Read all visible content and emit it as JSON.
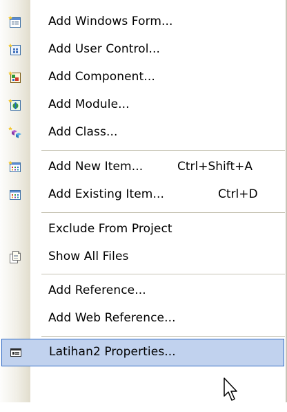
{
  "menu": {
    "items": [
      {
        "label": "Add Windows Form...",
        "icon": "windows-form-icon"
      },
      {
        "label": "Add User Control...",
        "icon": "user-control-icon"
      },
      {
        "label": "Add Component...",
        "icon": "component-icon"
      },
      {
        "label": "Add Module...",
        "icon": "module-icon"
      },
      {
        "label": "Add Class...",
        "icon": "class-icon"
      },
      {
        "label": "Add New Item...",
        "shortcut": "Ctrl+Shift+A",
        "icon": "new-item-icon"
      },
      {
        "label": "Add Existing Item...",
        "shortcut": "Ctrl+D",
        "icon": "existing-item-icon"
      },
      {
        "label": "Exclude From Project"
      },
      {
        "label": "Show All Files",
        "icon": "show-all-files-icon"
      },
      {
        "label": "Add Reference..."
      },
      {
        "label": "Add Web Reference..."
      },
      {
        "label": "Latihan2 Properties...",
        "icon": "properties-icon",
        "highlighted": true
      }
    ]
  },
  "colors": {
    "highlight_fill": "#c1d2ee",
    "highlight_border": "#316ac5",
    "gutter": "#f1efe7",
    "separator": "#c5c2b2"
  }
}
